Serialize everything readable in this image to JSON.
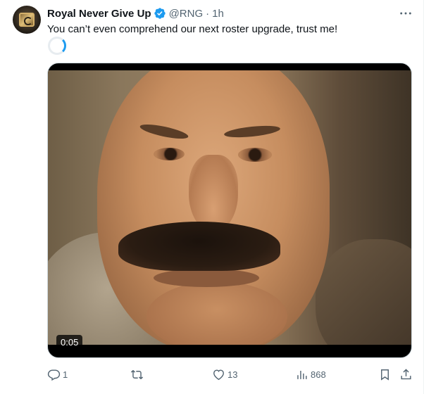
{
  "author": {
    "display_name": "Royal Never Give Up",
    "handle": "@RNG",
    "separator": "·",
    "time": "1h",
    "verified": true,
    "avatar_icon": "rng-logo-avatar"
  },
  "post": {
    "text": "You can’t even comprehend our next roster upgrade, trust me!"
  },
  "media": {
    "type": "video",
    "duration": "0:05"
  },
  "actions": {
    "replies": "1",
    "reposts": "",
    "likes": "13",
    "views": "868"
  },
  "colors": {
    "verified_badge": "#1d9bf0",
    "secondary_text": "#536471",
    "primary_text": "#0f1419"
  }
}
